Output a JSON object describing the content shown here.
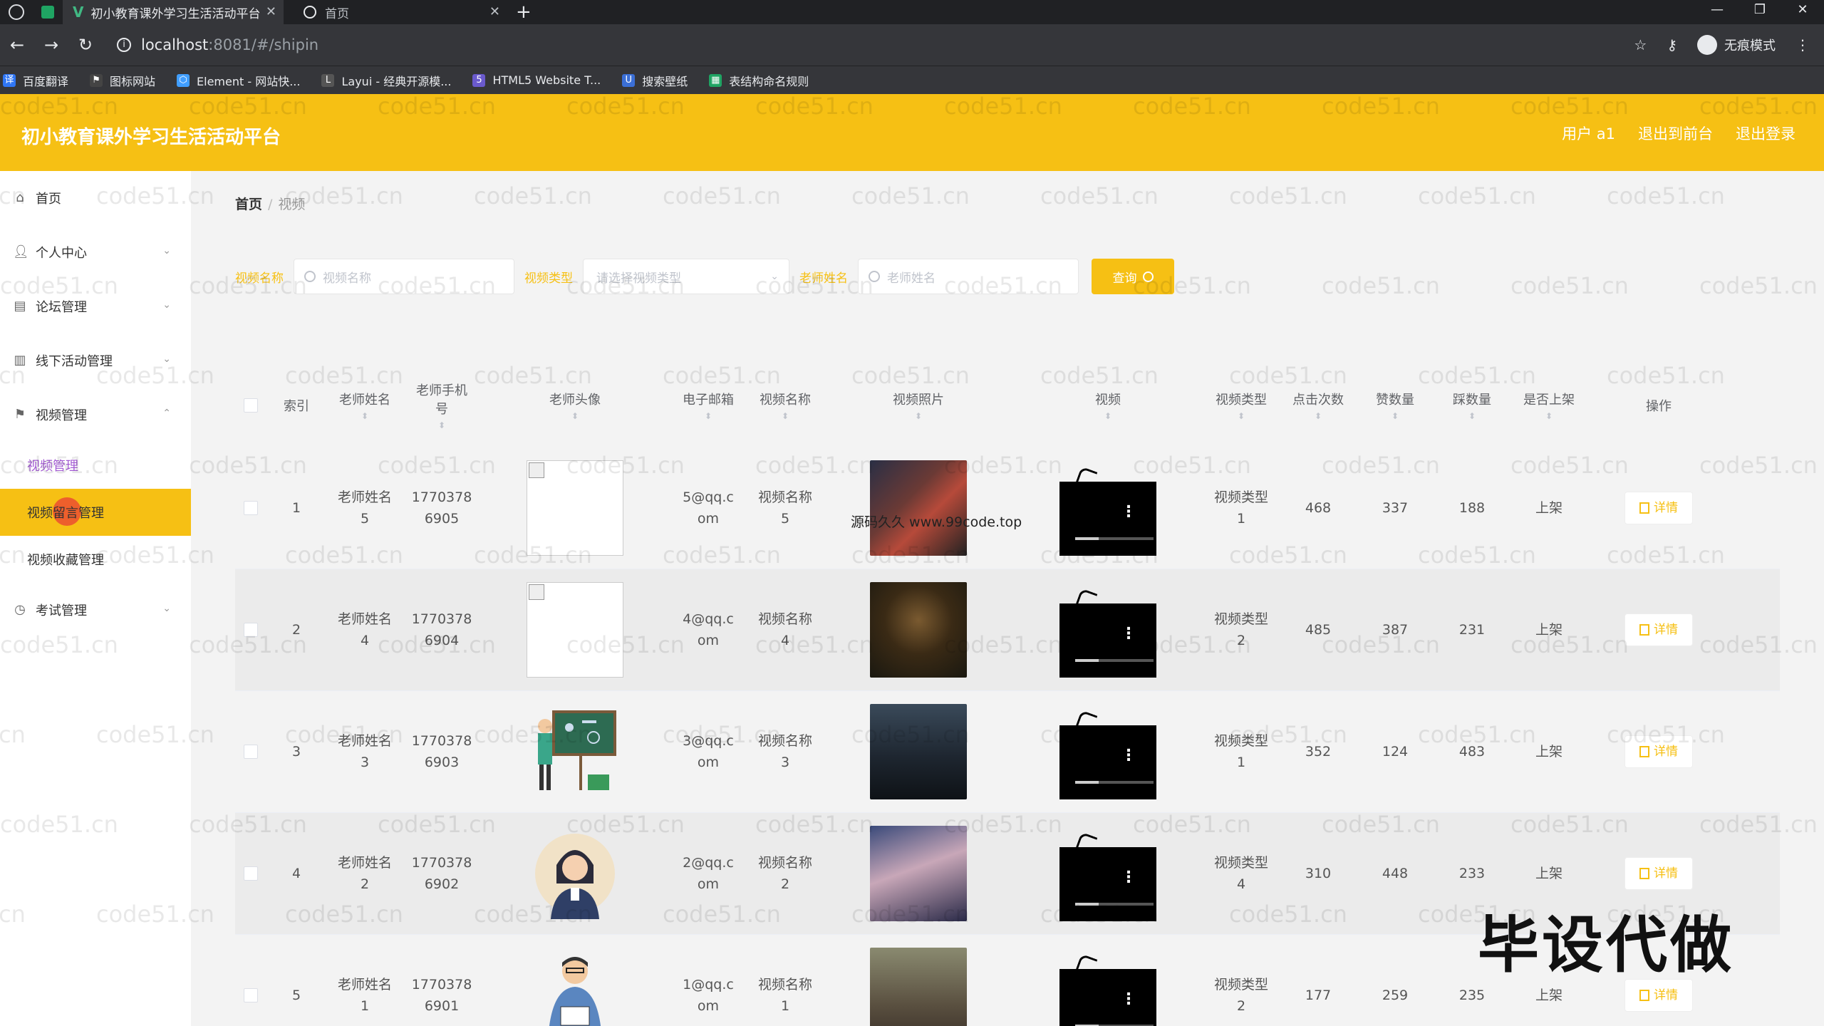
{
  "browser": {
    "active_tab_title": "初小教育课外学习生活活动平台",
    "inactive_tab_title": "首页",
    "url_host": "localhost",
    "url_path": ":8081/#/shipin",
    "incognito_label": "无痕模式",
    "bookmarks": [
      {
        "label": "百度翻译",
        "icon": "baidu-translate-icon",
        "color": "#2f76f5"
      },
      {
        "label": "图标网站",
        "icon": "flag-icon",
        "color": "#444"
      },
      {
        "label": "Element - 网站快...",
        "icon": "element-icon",
        "color": "#409eff"
      },
      {
        "label": "Layui - 经典开源模...",
        "icon": "layui-icon",
        "color": "#555"
      },
      {
        "label": "HTML5 Website T...",
        "icon": "html5-icon",
        "color": "#6a5acd"
      },
      {
        "label": "搜索壁纸",
        "icon": "search-wallpaper-icon",
        "color": "#3b6fd6"
      },
      {
        "label": "表结构命名规则",
        "icon": "sheet-icon",
        "color": "#1fa463"
      }
    ]
  },
  "header": {
    "title": "初小教育课外学习生活活动平台",
    "user_label": "用户 a1",
    "front_label": "退出到前台",
    "logout_label": "退出登录",
    "accent": "#f6c014"
  },
  "sidebar": {
    "items": [
      {
        "label": "首页",
        "icon": "home-icon"
      },
      {
        "label": "个人中心",
        "icon": "user-icon"
      },
      {
        "label": "论坛管理",
        "icon": "forum-icon"
      },
      {
        "label": "线下活动管理",
        "icon": "chart-icon"
      },
      {
        "label": "视频管理",
        "icon": "flag-icon"
      }
    ],
    "sub_items": [
      {
        "label": "视频管理"
      },
      {
        "label": "视频留言管理"
      },
      {
        "label": "视频收藏管理"
      }
    ],
    "exam": {
      "label": "考试管理",
      "icon": "clock-icon"
    }
  },
  "breadcrumb": {
    "home": "首页",
    "current": "视频"
  },
  "filters": {
    "video_name_label": "视频名称",
    "video_name_placeholder": "视频名称",
    "video_type_label": "视频类型",
    "video_type_placeholder": "请选择视频类型",
    "teacher_label": "老师姓名",
    "teacher_placeholder": "老师姓名",
    "query_label": "查询"
  },
  "table": {
    "headers": [
      "索引",
      "老师姓名",
      "老师手机号",
      "老师头像",
      "电子邮箱",
      "视频名称",
      "视频照片",
      "视频",
      "视频类型",
      "点击次数",
      "赞数量",
      "踩数量",
      "是否上架",
      "操作"
    ],
    "rows": [
      {
        "idx": "1",
        "name_a": "老师姓名",
        "name_b": "5",
        "phone_a": "1770378",
        "phone_b": "6905",
        "email_a": "5@qq.c",
        "email_b": "om",
        "vname_a": "视频名称",
        "vname_b": "5",
        "type_a": "视频类型",
        "type_b": "1",
        "clicks": "468",
        "likes": "337",
        "dislikes": "188",
        "status": "上架",
        "avatar": "broken",
        "poster": "poster-1"
      },
      {
        "idx": "2",
        "name_a": "老师姓名",
        "name_b": "4",
        "phone_a": "1770378",
        "phone_b": "6904",
        "email_a": "4@qq.c",
        "email_b": "om",
        "vname_a": "视频名称",
        "vname_b": "4",
        "type_a": "视频类型",
        "type_b": "2",
        "clicks": "485",
        "likes": "387",
        "dislikes": "231",
        "status": "上架",
        "avatar": "broken",
        "poster": "poster-2"
      },
      {
        "idx": "3",
        "name_a": "老师姓名",
        "name_b": "3",
        "phone_a": "1770378",
        "phone_b": "6903",
        "email_a": "3@qq.c",
        "email_b": "om",
        "vname_a": "视频名称",
        "vname_b": "3",
        "type_a": "视频类型",
        "type_b": "1",
        "clicks": "352",
        "likes": "124",
        "dislikes": "483",
        "status": "上架",
        "avatar": "teacher-board",
        "poster": "poster-3"
      },
      {
        "idx": "4",
        "name_a": "老师姓名",
        "name_b": "2",
        "phone_a": "1770378",
        "phone_b": "6902",
        "email_a": "2@qq.c",
        "email_b": "om",
        "vname_a": "视频名称",
        "vname_b": "2",
        "type_a": "视频类型",
        "type_b": "4",
        "clicks": "310",
        "likes": "448",
        "dislikes": "233",
        "status": "上架",
        "avatar": "teacher-woman",
        "poster": "poster-4"
      },
      {
        "idx": "5",
        "name_a": "老师姓名",
        "name_b": "1",
        "phone_a": "1770378",
        "phone_b": "6901",
        "email_a": "1@qq.c",
        "email_b": "om",
        "vname_a": "视频名称",
        "vname_b": "1",
        "type_a": "视频类型",
        "type_b": "2",
        "clicks": "177",
        "likes": "259",
        "dislikes": "235",
        "status": "上架",
        "avatar": "teacher-man",
        "poster": "poster-5"
      }
    ],
    "detail_label": "详情"
  },
  "overlay_text": "源码久久 www.99code.top",
  "watermark_text": "code51.cn",
  "caption": "毕设代做"
}
